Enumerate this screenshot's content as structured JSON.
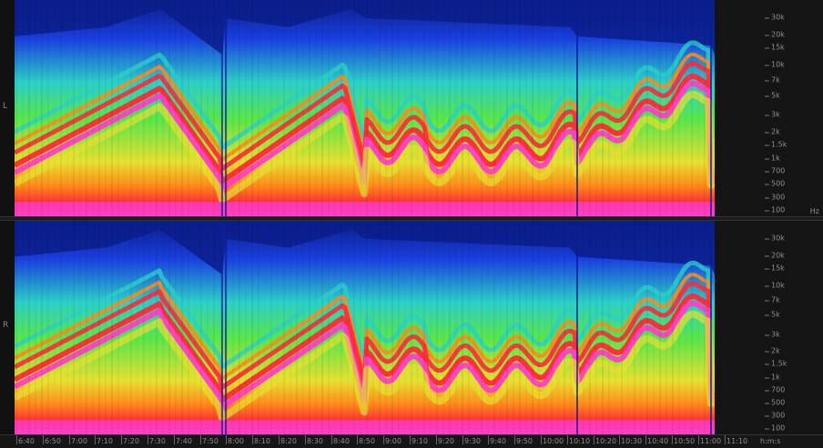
{
  "channels": [
    {
      "id": "L",
      "label": "L"
    },
    {
      "id": "R",
      "label": "R"
    }
  ],
  "frequency_axis": {
    "unit": "Hz",
    "labels": [
      "30k",
      "20k",
      "15k",
      "10k",
      "7k",
      "5k",
      "3k",
      "2k",
      "1.5k",
      "1k",
      "700",
      "500",
      "300",
      "100"
    ]
  },
  "time_axis": {
    "unit": "h:m:s",
    "labels": [
      "6:40",
      "6:50",
      "7:00",
      "7:10",
      "7:20",
      "7:30",
      "7:40",
      "7:50",
      "8:00",
      "8:10",
      "8:20",
      "8:30",
      "8:40",
      "8:50",
      "9:00",
      "9:10",
      "9:20",
      "9:30",
      "9:40",
      "9:50",
      "10:00",
      "10:10",
      "10:20",
      "10:30",
      "10:40",
      "10:50",
      "11:00",
      "11:10"
    ]
  },
  "colors": {
    "background": "#0a1d8a",
    "low": "#1a3fe0",
    "mid": "#2bd0c8",
    "green": "#59e64a",
    "yellow": "#e8e030",
    "orange": "#ff8a1a",
    "red": "#ff2a3a",
    "magenta": "#ff3fc8"
  }
}
